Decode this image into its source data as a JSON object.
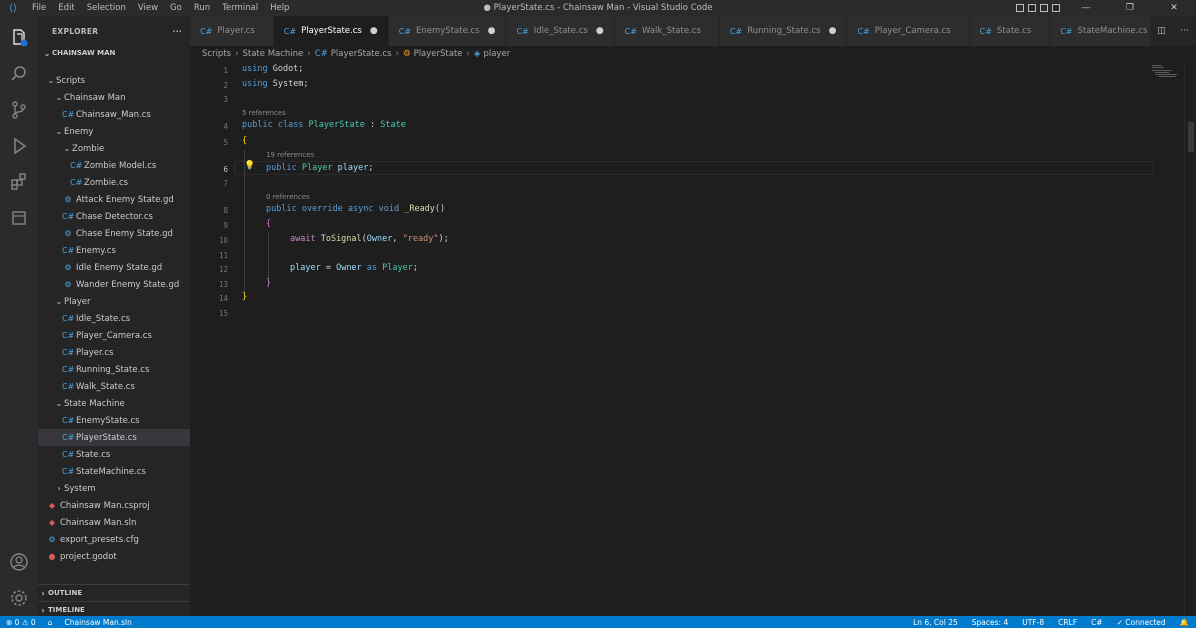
{
  "window": {
    "title": "● PlayerState.cs - Chainsaw Man - Visual Studio Code",
    "menu": [
      "File",
      "Edit",
      "Selection",
      "View",
      "Go",
      "Run",
      "Terminal",
      "Help"
    ]
  },
  "sidebar": {
    "header": "EXPLORER",
    "more": "···",
    "project": "CHAINSAW MAN",
    "tree": [
      {
        "label": "Scripts",
        "kind": "folder",
        "depth": 0,
        "open": true
      },
      {
        "label": "Chainsaw Man",
        "kind": "folder",
        "depth": 1,
        "open": true
      },
      {
        "label": "Chainsaw_Man.cs",
        "kind": "cs",
        "depth": 2
      },
      {
        "label": "Enemy",
        "kind": "folder",
        "depth": 1,
        "open": true
      },
      {
        "label": "Zombie",
        "kind": "folder",
        "depth": 2,
        "open": true
      },
      {
        "label": "Zombie Model.cs",
        "kind": "cs",
        "depth": 3
      },
      {
        "label": "Zombie.cs",
        "kind": "cs",
        "depth": 3
      },
      {
        "label": "Attack Enemy State.gd",
        "kind": "gd",
        "depth": 2
      },
      {
        "label": "Chase Detector.cs",
        "kind": "cs",
        "depth": 2
      },
      {
        "label": "Chase Enemy State.gd",
        "kind": "gd",
        "depth": 2
      },
      {
        "label": "Enemy.cs",
        "kind": "cs",
        "depth": 2
      },
      {
        "label": "Idle Enemy State.gd",
        "kind": "gd",
        "depth": 2
      },
      {
        "label": "Wander Enemy State.gd",
        "kind": "gd",
        "depth": 2
      },
      {
        "label": "Player",
        "kind": "folder",
        "depth": 1,
        "open": true
      },
      {
        "label": "Idle_State.cs",
        "kind": "cs",
        "depth": 2
      },
      {
        "label": "Player_Camera.cs",
        "kind": "cs",
        "depth": 2
      },
      {
        "label": "Player.cs",
        "kind": "cs",
        "depth": 2
      },
      {
        "label": "Running_State.cs",
        "kind": "cs",
        "depth": 2
      },
      {
        "label": "Walk_State.cs",
        "kind": "cs",
        "depth": 2
      },
      {
        "label": "State Machine",
        "kind": "folder",
        "depth": 1,
        "open": true
      },
      {
        "label": "EnemyState.cs",
        "kind": "cs",
        "depth": 2
      },
      {
        "label": "PlayerState.cs",
        "kind": "cs",
        "depth": 2,
        "selected": true
      },
      {
        "label": "State.cs",
        "kind": "cs",
        "depth": 2
      },
      {
        "label": "StateMachine.cs",
        "kind": "cs",
        "depth": 2
      },
      {
        "label": "System",
        "kind": "folder",
        "depth": 1,
        "open": false
      },
      {
        "label": "Chainsaw Man.csproj",
        "kind": "proj",
        "depth": 0
      },
      {
        "label": "Chainsaw Man.sln",
        "kind": "proj",
        "depth": 0
      },
      {
        "label": "export_presets.cfg",
        "kind": "cfg",
        "depth": 0
      },
      {
        "label": "project.godot",
        "kind": "godot",
        "depth": 0
      }
    ],
    "outline": "OUTLINE",
    "timeline": "TIMELINE"
  },
  "tabs": [
    {
      "label": "Player.cs",
      "modified": false,
      "active": false
    },
    {
      "label": "PlayerState.cs",
      "modified": true,
      "active": true
    },
    {
      "label": "EnemyState.cs",
      "modified": true,
      "active": false
    },
    {
      "label": "Idle_State.cs",
      "modified": true,
      "active": false
    },
    {
      "label": "Walk_State.cs",
      "modified": false,
      "active": false
    },
    {
      "label": "Running_State.cs",
      "modified": true,
      "active": false
    },
    {
      "label": "Player_Camera.cs",
      "modified": false,
      "active": false
    },
    {
      "label": "State.cs",
      "modified": false,
      "active": false
    },
    {
      "label": "StateMachine.cs",
      "modified": false,
      "active": false
    }
  ],
  "breadcrumb": [
    "Scripts",
    "State Machine",
    "PlayerState.cs",
    "PlayerState",
    "player"
  ],
  "editor": {
    "codelens": {
      "class": "5 references",
      "field": "19 references",
      "method": "0 references"
    },
    "line_numbers": [
      "1",
      "2",
      "3",
      "4",
      "5",
      "6",
      "7",
      "8",
      "9",
      "10",
      "11",
      "12",
      "13",
      "14",
      "15"
    ],
    "active_line": "6",
    "code": {
      "l1": [
        "using",
        " Godot;"
      ],
      "l2": [
        "using",
        " System;"
      ],
      "l4": [
        "public",
        " class",
        " PlayerState",
        " : ",
        "State"
      ],
      "l5": "{",
      "l6": [
        "public",
        " Player",
        " player",
        ";"
      ],
      "l8": [
        "public",
        " override",
        " async",
        " void",
        " _Ready",
        "()"
      ],
      "l9": "{",
      "l10": [
        "await",
        " ToSignal",
        "(",
        "Owner",
        ", ",
        "\"ready\"",
        ");"
      ],
      "l12": [
        "player",
        " = ",
        "Owner",
        " as ",
        "Player",
        ";"
      ],
      "l13": "}",
      "l14": "}"
    }
  },
  "statusbar": {
    "left": [
      "⊗ 0 ⚠ 0",
      "⌂",
      "Chainsaw Man.sln"
    ],
    "right": [
      "Ln 6, Col 25",
      "Spaces: 4",
      "UTF-8",
      "CRLF",
      "C#",
      "✓ Connected",
      "🔔"
    ]
  },
  "colors": {
    "accent": "#007acc",
    "keyword": "#569cd6",
    "type": "#4ec9b0",
    "string": "#ce9178"
  }
}
